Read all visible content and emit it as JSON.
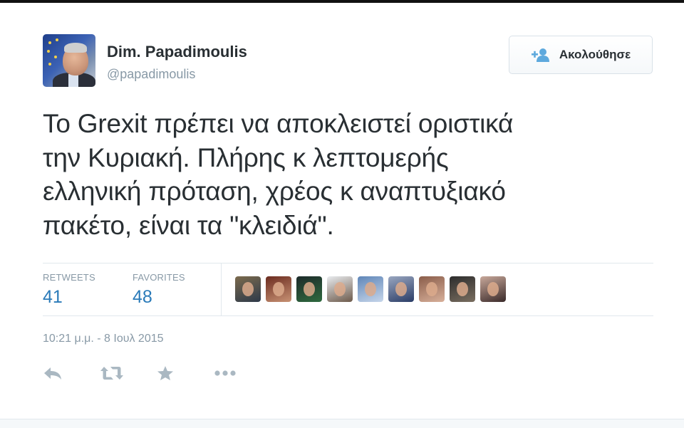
{
  "user": {
    "display_name": "Dim. Papadimoulis",
    "handle": "@papadimoulis"
  },
  "follow_button": {
    "label": "Ακολούθησε"
  },
  "tweet": {
    "lines": [
      "Το Grexit πρέπει να αποκλειστεί οριστικά",
      "την Κυριακή. Πλήρης κ λεπτομερής",
      "ελληνική πρόταση, χρέος κ αναπτυξιακό",
      "πακέτο, είναι τα \"κλειδιά\"."
    ]
  },
  "stats": {
    "retweets_label": "RETWEETS",
    "retweets": "41",
    "favorites_label": "FAVORITES",
    "favorites": "48"
  },
  "favoriter_avatars": [
    {
      "colors": [
        "#7b6a4d",
        "#2e3a4a"
      ]
    },
    {
      "colors": [
        "#6b2b1f",
        "#c89274"
      ]
    },
    {
      "colors": [
        "#1d2a2a",
        "#2f6a3f"
      ]
    },
    {
      "colors": [
        "#e9ecef",
        "#6d5a4b"
      ]
    },
    {
      "colors": [
        "#5f86b8",
        "#c7d6ea"
      ]
    },
    {
      "colors": [
        "#9aa7c0",
        "#2a3c66"
      ]
    },
    {
      "colors": [
        "#8a5d4a",
        "#d8b09a"
      ]
    },
    {
      "colors": [
        "#2c2c2c",
        "#7a6e60"
      ]
    },
    {
      "colors": [
        "#c8a89a",
        "#3a2a2a"
      ]
    }
  ],
  "timestamp": "10:21 μ.μ. - 8 Ιουλ 2015",
  "colors": {
    "link_blue": "#2b7bb9",
    "muted": "#8899a6",
    "icon": "#aab8c2"
  },
  "icons": [
    "reply-icon",
    "retweet-icon",
    "favorite-icon",
    "more-icon",
    "follow-person-plus-icon"
  ]
}
